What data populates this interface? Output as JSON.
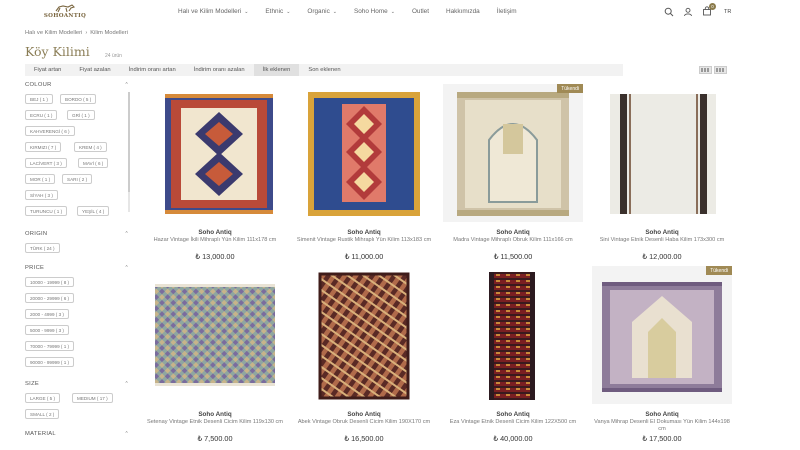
{
  "header": {
    "logo_text": "SOHOANTIQ",
    "nav": [
      {
        "label": "Halı ve Kilim Modelleri",
        "chevron": true
      },
      {
        "label": "Ethnic",
        "chevron": true
      },
      {
        "label": "Organic",
        "chevron": true
      },
      {
        "label": "Soho Home",
        "chevron": true
      },
      {
        "label": "Outlet",
        "chevron": false
      },
      {
        "label": "Hakkımızda",
        "chevron": false
      },
      {
        "label": "İletişim",
        "chevron": false
      }
    ],
    "cart_count": "0",
    "lang": "TR"
  },
  "breadcrumb": [
    "Halı ve Kilim Modelleri",
    "Kilim Modelleri"
  ],
  "page": {
    "title": "Köy Kilimi",
    "count": "24 ürün"
  },
  "sort": {
    "tabs": [
      "Fiyat artan",
      "Fiyat azalan",
      "İndirim oranı artan",
      "İndirim oranı azalan",
      "İlk eklenen",
      "Son eklenen"
    ],
    "active_index": 4
  },
  "filters": {
    "colour": {
      "label": "COLOUR",
      "chips": [
        "BEJ ( 1 )",
        "BORDO ( 5 )",
        "ECRU ( 1 )",
        "GRİ ( 1 )",
        "KAHVERENGİ ( 6 )",
        "KIRMIZI ( 7 )",
        "KREM ( 4 )",
        "LACİVERT ( 3 )",
        "MAVİ ( 6 )",
        "MOR ( 1 )",
        "SARI ( 2 )",
        "SİYAH ( 3 )",
        "TURUNCU ( 1 )",
        "YEŞİL ( 4 )"
      ]
    },
    "origin": {
      "label": "ORIGIN",
      "chips": [
        "TÜRK ( 24 )"
      ]
    },
    "price": {
      "label": "PRICE",
      "chips": [
        "10000 - 19999 ( 8 )",
        "20000 - 29999 ( 6 )",
        "2000 - 4999 ( 3 )",
        "5000 - 9999 ( 3 )",
        "70000 - 79999 ( 1 )",
        "90000 - 99999 ( 1 )"
      ]
    },
    "size": {
      "label": "SIZE",
      "chips": [
        "LARGE ( 5 )",
        "MEDIUM ( 17 )",
        "SMALL ( 2 )"
      ]
    },
    "material": {
      "label": "MATERIAL",
      "chips": []
    }
  },
  "products": [
    {
      "brand": "Soho Antiq",
      "name": "Hazar Vintage İkili Mihraplı Yün Kilim 111x178 cm",
      "price": "₺ 13,000.00",
      "badge": ""
    },
    {
      "brand": "Soho Antiq",
      "name": "Simenit Vintage Rustik Mihraplı Yün Kilim 113x183 cm",
      "price": "₺ 11,000.00",
      "badge": ""
    },
    {
      "brand": "Soho Antiq",
      "name": "Madra Vintage Mihraplı Obruk Kilim 111x166 cm",
      "price": "₺ 11,500.00",
      "badge": "Tükendi"
    },
    {
      "brand": "Soho Antiq",
      "name": "Sini Vintage Etnik Desenli Haba Kilim 173x300 cm",
      "price": "₺ 12,000.00",
      "badge": ""
    },
    {
      "brand": "Soho Antiq",
      "name": "Setenay Vintage Etnik Desenli Cicim Kilim 119x130 cm",
      "price": "₺ 7,500.00",
      "badge": ""
    },
    {
      "brand": "Soho Antiq",
      "name": "Abek Vintage Obruk Desenli Cicim Kilim 190X170 cm",
      "price": "₺ 16,500.00",
      "badge": ""
    },
    {
      "brand": "Soho Antiq",
      "name": "Eza Vintage Etnik Desenli Cicim Kilim 122X500 cm",
      "price": "₺ 40,000.00",
      "badge": ""
    },
    {
      "brand": "Soho Antiq",
      "name": "Vanya Mihrap Desenli El Dokuması Yün Kilim 144x198 cm",
      "price": "₺ 17,500.00",
      "badge": "Tükendi"
    }
  ],
  "colors": {
    "accent": "#8a7d55",
    "badge": "#a08a55",
    "sort_bg": "#f2f2f2"
  },
  "icons": [
    "search-icon",
    "user-icon",
    "cart-icon",
    "grid-view-icon",
    "list-view-icon",
    "chevron-down-icon",
    "chevron-up-icon"
  ]
}
